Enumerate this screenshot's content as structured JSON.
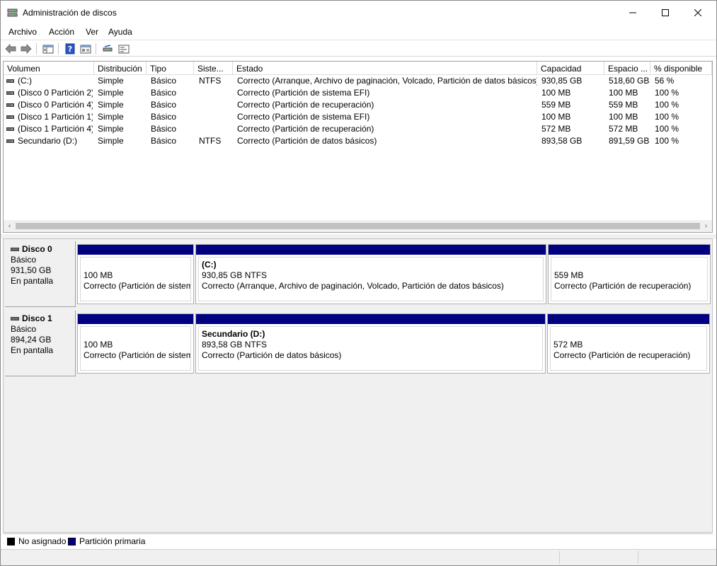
{
  "window": {
    "title": "Administración de discos",
    "minimize_glyph": "—",
    "maximize_glyph": "☐",
    "close_glyph": "✕"
  },
  "menu": [
    "Archivo",
    "Acción",
    "Ver",
    "Ayuda"
  ],
  "toolbar_icons": [
    "back-icon",
    "forward-icon",
    "show-hide-console-tree-icon",
    "help-icon",
    "properties-icon",
    "rescan-disks-icon",
    "settings-icon"
  ],
  "volume_list": {
    "columns": [
      "Volumen",
      "Distribución",
      "Tipo",
      "Siste...",
      "Estado",
      "Capacidad",
      "Espacio ...",
      "% disponible"
    ],
    "rows": [
      {
        "volume": "(C:)",
        "layout": "Simple",
        "type": "Básico",
        "fs": "NTFS",
        "status": "Correcto (Arranque, Archivo de paginación, Volcado, Partición de datos básicos)",
        "capacity": "930,85 GB",
        "free": "518,60 GB",
        "pct": "56 %"
      },
      {
        "volume": "(Disco 0 Partición 2)",
        "layout": "Simple",
        "type": "Básico",
        "fs": "",
        "status": "Correcto (Partición de sistema EFI)",
        "capacity": "100 MB",
        "free": "100 MB",
        "pct": "100 %"
      },
      {
        "volume": "(Disco 0 Partición 4)",
        "layout": "Simple",
        "type": "Básico",
        "fs": "",
        "status": "Correcto (Partición de recuperación)",
        "capacity": "559 MB",
        "free": "559 MB",
        "pct": "100 %"
      },
      {
        "volume": "(Disco 1 Partición 1)",
        "layout": "Simple",
        "type": "Básico",
        "fs": "",
        "status": "Correcto (Partición de sistema EFI)",
        "capacity": "100 MB",
        "free": "100 MB",
        "pct": "100 %"
      },
      {
        "volume": "(Disco 1 Partición 4)",
        "layout": "Simple",
        "type": "Básico",
        "fs": "",
        "status": "Correcto (Partición de recuperación)",
        "capacity": "572 MB",
        "free": "572 MB",
        "pct": "100 %"
      },
      {
        "volume": "Secundario (D:)",
        "layout": "Simple",
        "type": "Básico",
        "fs": "NTFS",
        "status": "Correcto (Partición de datos básicos)",
        "capacity": "893,58 GB",
        "free": "891,59 GB",
        "pct": "100 %"
      }
    ],
    "scroll_left_glyph": "‹",
    "scroll_right_glyph": "›"
  },
  "disks": [
    {
      "name": "Disco 0",
      "type": "Básico",
      "size": "931,50 GB",
      "state": "En pantalla",
      "partitions": [
        {
          "label": "",
          "size": "100 MB",
          "status": "Correcto (Partición de sistem"
        },
        {
          "label": "(C:)",
          "size": "930,85 GB NTFS",
          "status": "Correcto (Arranque, Archivo de paginación, Volcado, Partición de datos básicos)"
        },
        {
          "label": "",
          "size": "559 MB",
          "status": "Correcto (Partición de recuperación)"
        }
      ]
    },
    {
      "name": "Disco 1",
      "type": "Básico",
      "size": "894,24 GB",
      "state": "En pantalla",
      "partitions": [
        {
          "label": "",
          "size": "100 MB",
          "status": "Correcto (Partición de sistem"
        },
        {
          "label": "Secundario  (D:)",
          "size": "893,58 GB NTFS",
          "status": "Correcto (Partición de datos básicos)"
        },
        {
          "label": "",
          "size": "572 MB",
          "status": "Correcto (Partición de recuperación)"
        }
      ]
    }
  ],
  "legend": [
    {
      "label": "No asignado",
      "color": "#000000"
    },
    {
      "label": "Partición primaria",
      "color": "#000080"
    }
  ],
  "colors": {
    "partition_bar": "#000080",
    "unallocated": "#000000"
  }
}
